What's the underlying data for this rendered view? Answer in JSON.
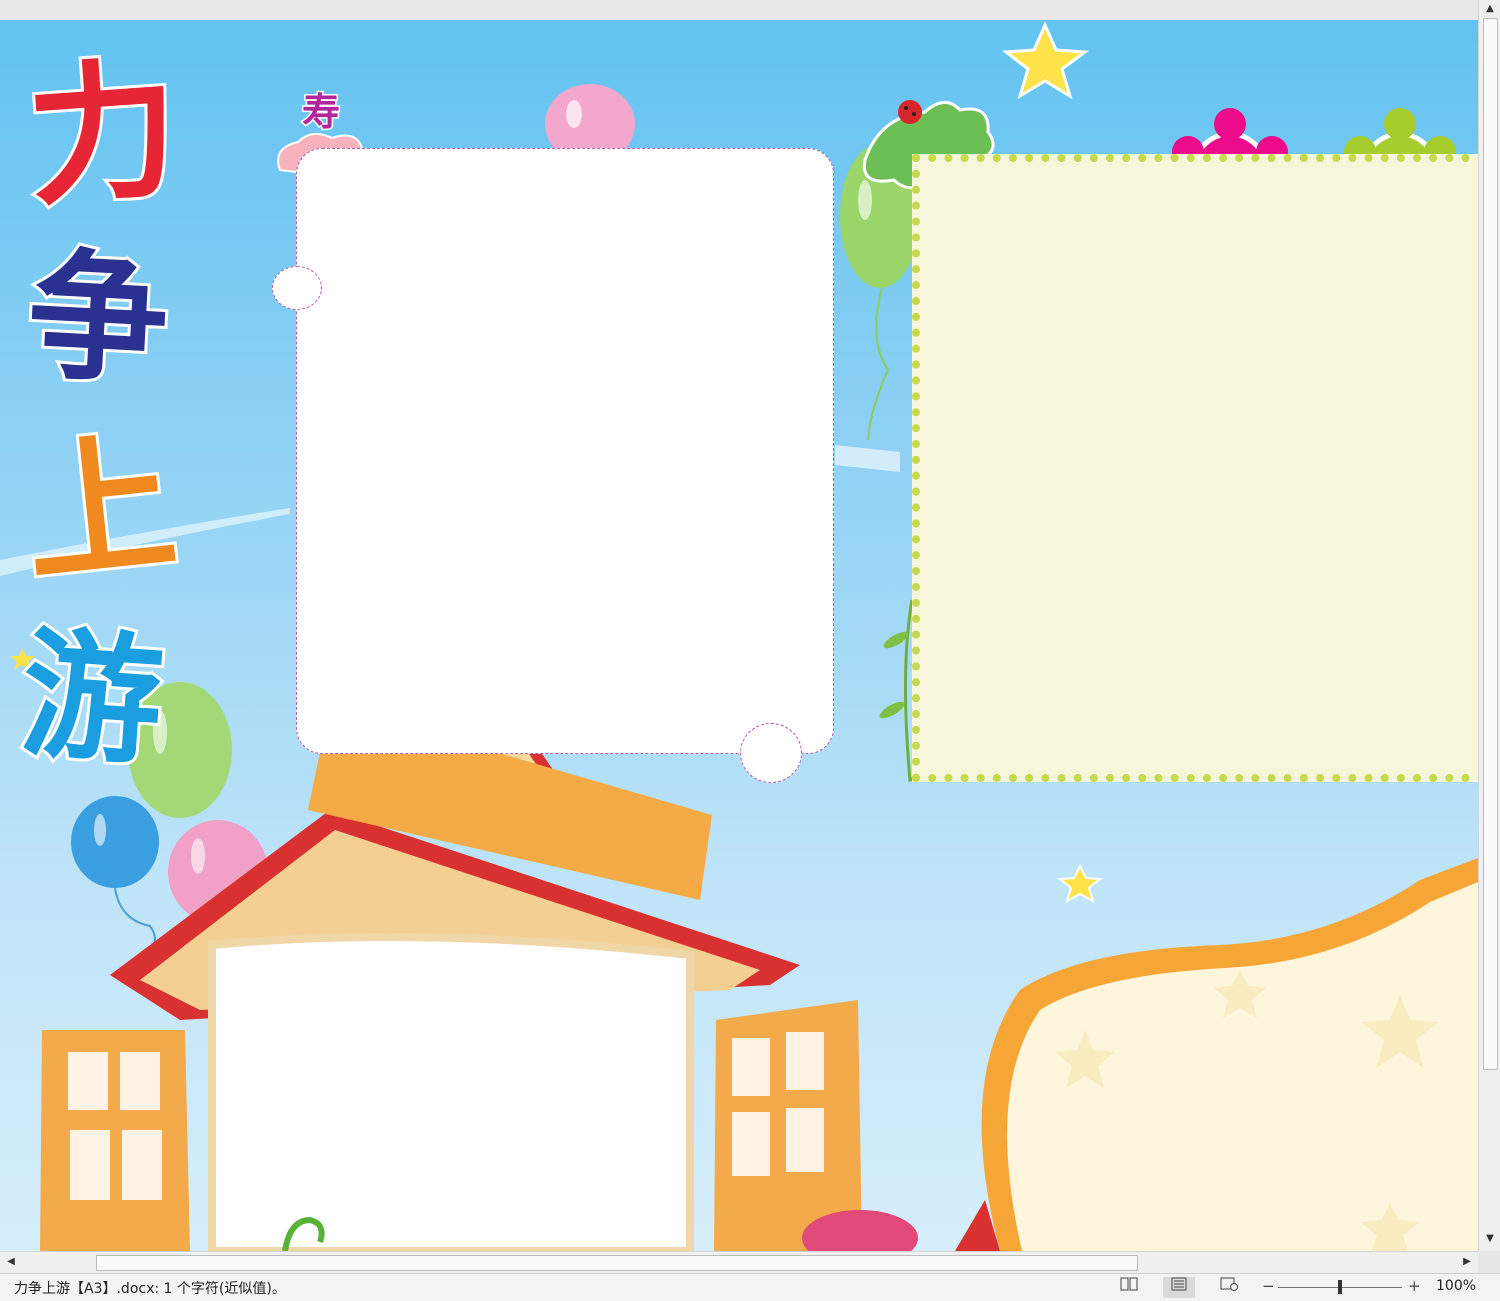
{
  "document": {
    "title_chars": [
      "力",
      "争",
      "上",
      "游"
    ],
    "title_colors": [
      "#e62535",
      "#2b3190",
      "#f08a1e",
      "#1a9ee0"
    ],
    "cloud_glyph": "寿"
  },
  "statusbar": {
    "text": "力争上游【A3】.docx: 1 个字符(近似值)。",
    "view_read_icon": "read-mode-icon",
    "view_print_icon": "print-layout-icon",
    "view_web_icon": "web-layout-icon",
    "zoom_minus": "−",
    "zoom_plus": "+",
    "zoom_level": "100%"
  },
  "scrollbars": {
    "up": "▲",
    "down": "▼",
    "left": "◀",
    "right": "▶"
  }
}
